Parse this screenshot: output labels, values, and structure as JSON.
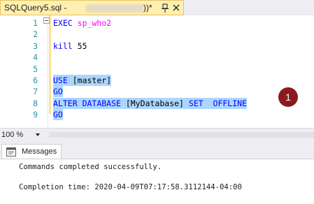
{
  "tab": {
    "title": "SQLQuery5.sql - ",
    "suffix": "))*"
  },
  "editor": {
    "lines": [
      {
        "num": "1",
        "tokens": [
          {
            "t": "EXEC",
            "c": "kw"
          },
          {
            "t": " ",
            "c": "blk"
          },
          {
            "t": "sp_who2",
            "c": "mg"
          }
        ]
      },
      {
        "num": "2",
        "tokens": []
      },
      {
        "num": "3",
        "tokens": [
          {
            "t": "kill",
            "c": "kw"
          },
          {
            "t": " 55",
            "c": "blk"
          }
        ]
      },
      {
        "num": "4",
        "tokens": []
      },
      {
        "num": "5",
        "tokens": []
      },
      {
        "num": "6",
        "tokens": [
          {
            "t": "USE",
            "c": "kw"
          },
          {
            "t": " ",
            "c": "blk"
          },
          {
            "t": "[master]",
            "c": "blk"
          }
        ],
        "selected": true
      },
      {
        "num": "7",
        "tokens": [
          {
            "t": "GO",
            "c": "kw"
          }
        ],
        "selected": true
      },
      {
        "num": "8",
        "tokens": [
          {
            "t": "ALTER",
            "c": "kw"
          },
          {
            "t": " ",
            "c": "blk"
          },
          {
            "t": "DATABASE",
            "c": "kw"
          },
          {
            "t": " [MyDatabase] ",
            "c": "blk"
          },
          {
            "t": "SET",
            "c": "kw"
          },
          {
            "t": "  ",
            "c": "blk"
          },
          {
            "t": "OFFLINE",
            "c": "kw"
          }
        ],
        "selected": true
      },
      {
        "num": "9",
        "tokens": [
          {
            "t": "GO",
            "c": "kw"
          }
        ],
        "selected": true
      }
    ],
    "badge": "1"
  },
  "zoom": {
    "value": "100 %"
  },
  "results": {
    "tab_label": "Messages",
    "lines": [
      "Commands completed successfully.",
      "",
      "Completion time: 2020-04-09T07:17:58.3112144-04:00"
    ]
  },
  "colors": {
    "keyword": "#0000ff",
    "system_proc": "#ff00ff",
    "selection": "#add6ff",
    "line_number": "#2b91af",
    "badge": "#8b1a1f",
    "tab_active": "#ffefb0"
  }
}
